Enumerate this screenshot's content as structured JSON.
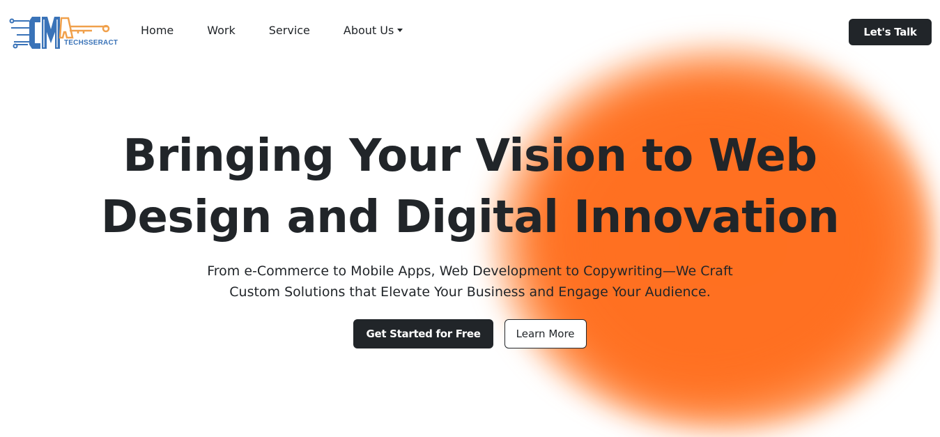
{
  "brand": {
    "logo_text": "TECHSSERACT",
    "logo_letters": "CMA",
    "colors": {
      "blue": "#3a73b8",
      "orange": "#f0a04b",
      "dark": "#212529",
      "accent_orange": "#ff7021"
    }
  },
  "nav": {
    "items": [
      {
        "label": "Home"
      },
      {
        "label": "Work"
      },
      {
        "label": "Service"
      },
      {
        "label": "About Us",
        "has_dropdown": true
      }
    ],
    "cta_label": "Let's Talk"
  },
  "hero": {
    "title_line1": "Bringing Your Vision to Web",
    "title_line2": "Design and Digital Innovation",
    "subtitle_line1": "From e-Commerce to Mobile Apps, Web Development to Copywriting—We Craft",
    "subtitle_line2": "Custom Solutions that Elevate Your Business and Engage Your Audience.",
    "primary_button": "Get Started for Free",
    "secondary_button": "Learn More"
  }
}
